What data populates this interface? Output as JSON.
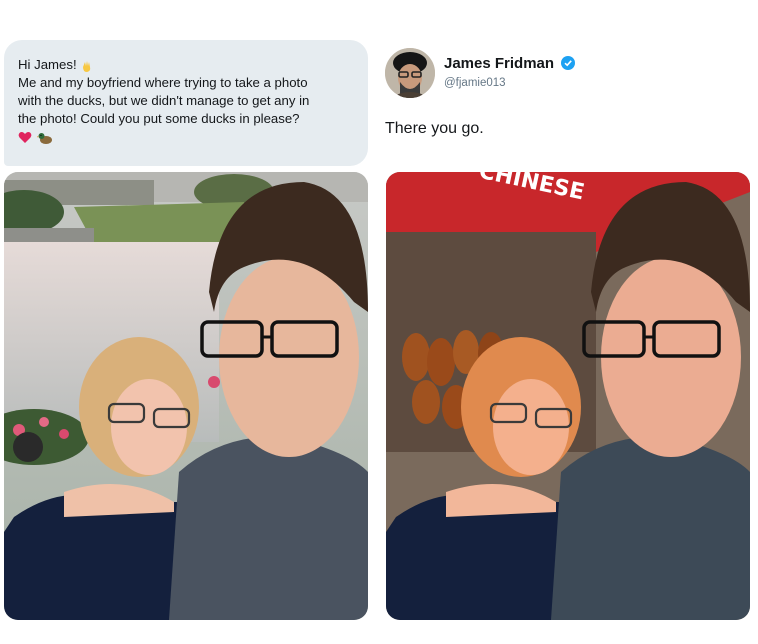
{
  "request": {
    "greeting": "Hi James!",
    "body": "Me and my boyfriend where trying to take a photo with the ducks, but we didn't manage to get any in the photo! Could you put some ducks in please?",
    "line1": "Me and my boyfriend where trying to take a photo",
    "line2": "with the ducks, but we didn't manage to get any in",
    "line3": "the photo! Could you put some ducks in please?",
    "emoji_wave": "waving-hand",
    "emoji_heart": "red-heart",
    "emoji_duck": "duck"
  },
  "reply": {
    "name": "James Fridman",
    "handle": "@fjamie013",
    "text": "There you go.",
    "verified": true
  },
  "photo_right": {
    "shop_sign": "CHINESE"
  },
  "colors": {
    "bubble": "#e6ecf0",
    "verified_blue": "#1da1f2",
    "handle_gray": "#657786",
    "sign_red": "#c8272b"
  }
}
